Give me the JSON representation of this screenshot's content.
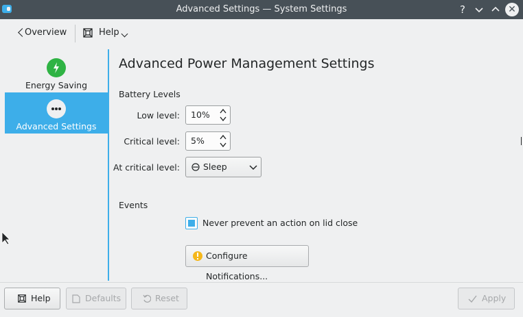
{
  "window": {
    "title": "Advanced Settings — System Settings",
    "controls": {
      "help": "?",
      "minimize": "⌄",
      "maximize": "⌃",
      "close": "✕"
    }
  },
  "toolbar": {
    "overview_label": "Overview",
    "help_label": "Help"
  },
  "sidebar": {
    "items": [
      {
        "label": "Energy Saving",
        "icon": "lightning-icon",
        "selected": false,
        "icon_color": "#2fb344"
      },
      {
        "label": "Advanced Settings",
        "icon": "more-dots-icon",
        "selected": true
      }
    ]
  },
  "main": {
    "title": "Advanced Power Management Settings",
    "battery": {
      "heading": "Battery Levels",
      "low_label": "Low level:",
      "low_value": "10%",
      "critical_label": "Critical level:",
      "critical_value": "5%",
      "action_label": "At critical level:",
      "action_value": "Sleep"
    },
    "events": {
      "heading": "Events",
      "lid_checkbox_label": "Never prevent an action on lid close",
      "lid_checked": true,
      "configure_button": "Configure Notifications..."
    }
  },
  "footer": {
    "help": "Help",
    "defaults": "Defaults",
    "reset": "Reset",
    "apply": "Apply"
  },
  "colors": {
    "accent": "#3daee9",
    "titlebar": "#475057",
    "background": "#eff0f1"
  }
}
